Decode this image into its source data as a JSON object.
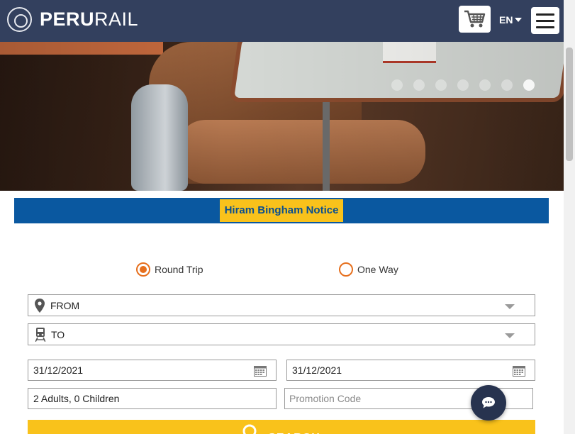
{
  "header": {
    "brand_bold": "PERU",
    "brand_light": "RAIL",
    "language": "EN",
    "cart_icon": "shopping-cart-icon",
    "menu_icon": "hamburger-menu-icon"
  },
  "hero": {
    "slides_count": 7,
    "active_slide": 7
  },
  "notice": {
    "label": "Hiram Bingham Notice"
  },
  "booking": {
    "trip_types": [
      {
        "label": "Round Trip",
        "selected": true
      },
      {
        "label": "One Way",
        "selected": false
      }
    ],
    "from_label": "FROM",
    "to_label": "TO",
    "departure_date": "31/12/2021",
    "return_date": "31/12/2021",
    "passengers": "2 Adults, 0 Children",
    "promo_placeholder": "Promotion Code",
    "search_label": "SEARCH"
  },
  "colors": {
    "header_bg": "#33405e",
    "notice_bg": "#0a58a0",
    "accent_yellow": "#f9c21b",
    "radio_orange": "#e66f1d"
  }
}
